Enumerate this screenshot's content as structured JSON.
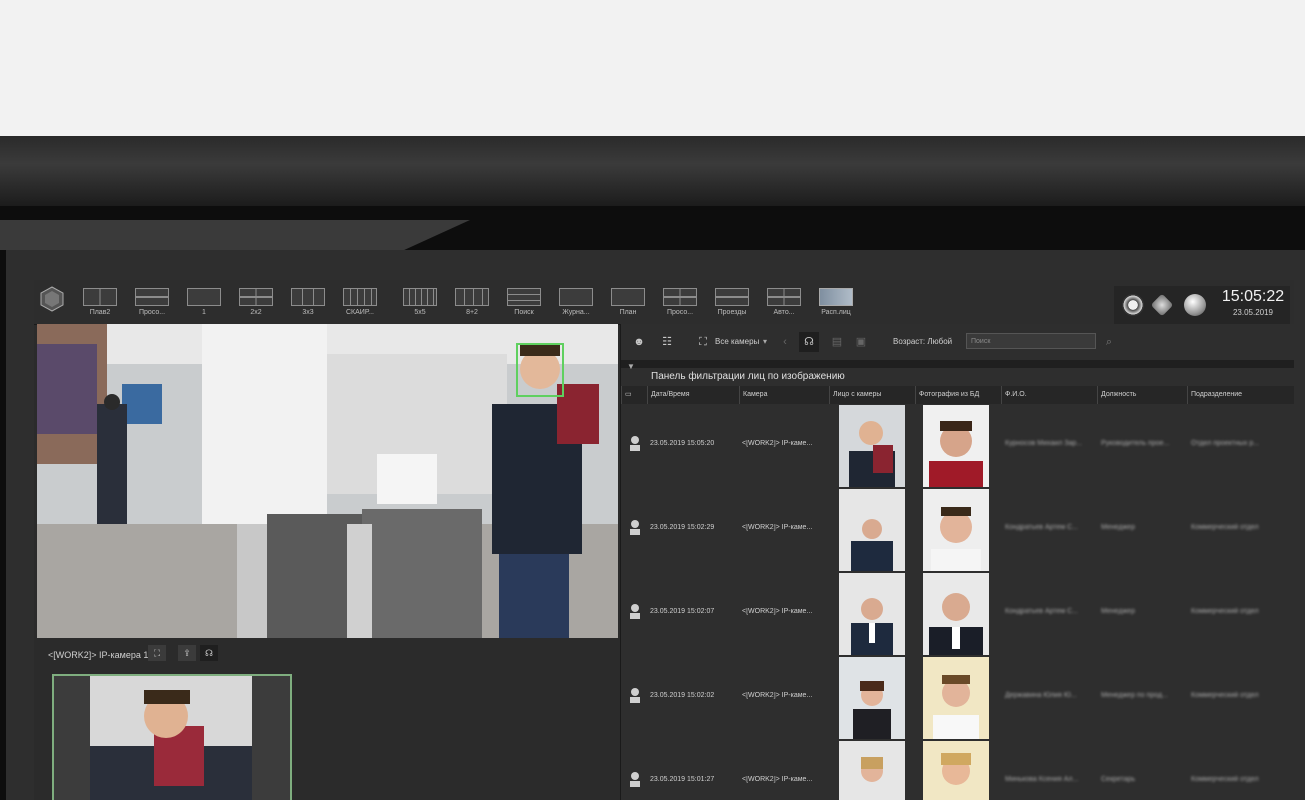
{
  "toolbar": {
    "layouts": [
      {
        "label": "Плав2"
      },
      {
        "label": "Просо..."
      },
      {
        "label": "1"
      },
      {
        "label": "2х2"
      },
      {
        "label": "3х3"
      },
      {
        "label": "СКАЙР..."
      },
      {
        "label": "5х5"
      },
      {
        "label": "8+2"
      },
      {
        "label": "Поиск"
      },
      {
        "label": "Журна..."
      },
      {
        "label": "План"
      },
      {
        "label": "Просо..."
      },
      {
        "label": "Проезды"
      },
      {
        "label": "Авто..."
      },
      {
        "label": "Расп.лиц"
      }
    ],
    "time": "15:05:22",
    "date": "23.05.2019"
  },
  "camera": {
    "title": "<[WORK2]> IP-камера 1"
  },
  "panel": {
    "all_cameras": "Все камеры",
    "age_label": "Возраст: Любой",
    "search_placeholder": "Поиск",
    "filter_title": "Панель фильтрации лиц по изображению",
    "columns": [
      "Дата/Время",
      "Камера",
      "Лицо с камеры",
      "Фотография из БД",
      "Ф.И.О.",
      "Должность",
      "Подразделение"
    ],
    "rows": [
      {
        "datetime": "23.05.2019 15:05:20",
        "camera": "<[WORK2]> IP-каме...",
        "name": "Курносов Михаил Зар...",
        "position": "Руководитель прое...",
        "department": "Отдел проектных р..."
      },
      {
        "datetime": "23.05.2019 15:02:29",
        "camera": "<[WORK2]> IP-каме...",
        "name": "Кондратьев Артем С...",
        "position": "Менеджер",
        "department": "Коммерческий отдел"
      },
      {
        "datetime": "23.05.2019 15:02:07",
        "camera": "<[WORK2]> IP-каме...",
        "name": "Кондратьев Артем С...",
        "position": "Менеджер",
        "department": "Коммерческий отдел"
      },
      {
        "datetime": "23.05.2019 15:02:02",
        "camera": "<[WORK2]> IP-каме...",
        "name": "Державина Юлия Ю...",
        "position": "Менеджер по прод...",
        "department": "Коммерческий отдел"
      },
      {
        "datetime": "23.05.2019 15:01:27",
        "camera": "<[WORK2]> IP-каме...",
        "name": "Минькова Ксения Ал...",
        "position": "Секретарь",
        "department": "Коммерческий отдел"
      }
    ]
  }
}
